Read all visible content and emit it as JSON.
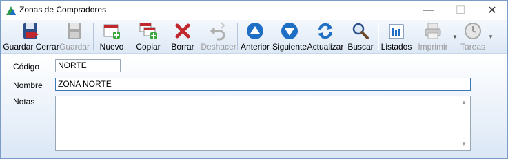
{
  "window": {
    "title": "Zonas de Compradores",
    "minimize": "—",
    "maximize": "☐",
    "close": "✕"
  },
  "toolbar": {
    "guardar_cerrar": "Guardar Cerrar",
    "guardar": "Guardar",
    "nuevo": "Nuevo",
    "copiar": "Copiar",
    "borrar": "Borrar",
    "deshacer": "Deshacer",
    "anterior": "Anterior",
    "siguiente": "Siguiente",
    "actualizar": "Actualizar",
    "buscar": "Buscar",
    "listados": "Listados",
    "imprimir": "Imprimir",
    "tareas": "Tareas"
  },
  "form": {
    "codigo_label": "Código",
    "codigo_value": "NORTE",
    "nombre_label": "Nombre",
    "nombre_value": "ZONA NORTE",
    "notas_label": "Notas",
    "notas_value": ""
  },
  "colors": {
    "accent": "#1f6fc4",
    "delete": "#c0282d",
    "add": "#3aa53a"
  }
}
